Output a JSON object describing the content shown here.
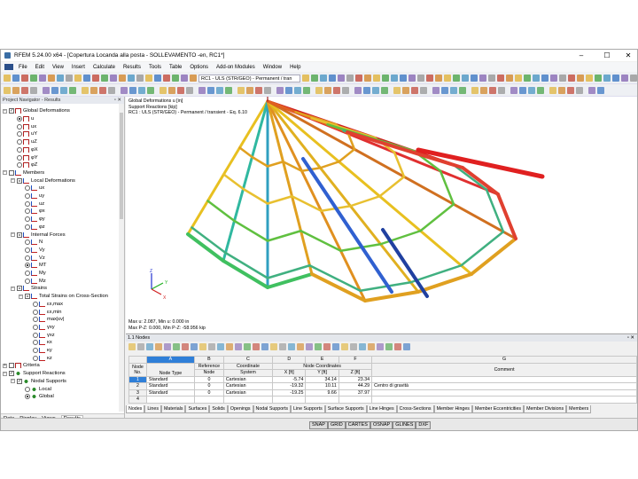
{
  "window": {
    "title": "RFEM 5.24.00 x64 - [Copertura Locanda alla posta - SOLLEVAMENTO -en, RC1*]",
    "minimize": "–",
    "maximize": "☐",
    "close": "✕"
  },
  "menu": [
    "File",
    "Edit",
    "View",
    "Insert",
    "Calculate",
    "Results",
    "Tools",
    "Table",
    "Options",
    "Add-on Modules",
    "Window",
    "Help"
  ],
  "toolbar": {
    "load_case": "RC1 - ULS (STR/GEO) - Permanent / tran"
  },
  "navigator": {
    "title": "Project Navigator - Results",
    "pin": "▫ ✕",
    "tabs": [
      "Data",
      "Display",
      "Views",
      "Results"
    ],
    "tree": [
      {
        "l": 0,
        "c": "box",
        "chk": true,
        "ic": "def",
        "t": "Global Deformations",
        "e": "-"
      },
      {
        "l": 1,
        "c": "rad",
        "on": true,
        "ic": "def",
        "t": "u"
      },
      {
        "l": 1,
        "c": "rad",
        "ic": "def",
        "t": "ux"
      },
      {
        "l": 1,
        "c": "rad",
        "ic": "def",
        "t": "uY"
      },
      {
        "l": 1,
        "c": "rad",
        "ic": "def",
        "t": "uZ"
      },
      {
        "l": 1,
        "c": "rad",
        "ic": "def",
        "t": "φX"
      },
      {
        "l": 1,
        "c": "rad",
        "ic": "def",
        "t": "φY"
      },
      {
        "l": 1,
        "c": "rad",
        "ic": "def",
        "t": "φZ"
      },
      {
        "l": 0,
        "c": "box",
        "ic": "mem",
        "t": "Members",
        "e": "-"
      },
      {
        "l": 1,
        "c": "box",
        "part": true,
        "ic": "mem",
        "t": "Local Deformations",
        "e": "-"
      },
      {
        "l": 2,
        "c": "rad",
        "ic": "mem",
        "t": "ux"
      },
      {
        "l": 2,
        "c": "rad",
        "ic": "mem",
        "t": "uy"
      },
      {
        "l": 2,
        "c": "rad",
        "ic": "mem",
        "t": "uz"
      },
      {
        "l": 2,
        "c": "rad",
        "ic": "mem",
        "t": "φx"
      },
      {
        "l": 2,
        "c": "rad",
        "ic": "mem",
        "t": "φy"
      },
      {
        "l": 2,
        "c": "rad",
        "ic": "mem",
        "t": "φz"
      },
      {
        "l": 1,
        "c": "box",
        "part": true,
        "ic": "mem",
        "t": "Internal Forces",
        "e": "-"
      },
      {
        "l": 2,
        "c": "rad",
        "ic": "mem",
        "t": "N"
      },
      {
        "l": 2,
        "c": "rad",
        "ic": "mem",
        "t": "Vy"
      },
      {
        "l": 2,
        "c": "rad",
        "ic": "mem",
        "t": "Vz"
      },
      {
        "l": 2,
        "c": "rad",
        "on": true,
        "ic": "mem",
        "t": "MT"
      },
      {
        "l": 2,
        "c": "rad",
        "ic": "mem",
        "t": "My"
      },
      {
        "l": 2,
        "c": "rad",
        "ic": "mem",
        "t": "Mz"
      },
      {
        "l": 1,
        "c": "box",
        "part": true,
        "ic": "mem",
        "t": "Strains",
        "e": "-"
      },
      {
        "l": 2,
        "c": "box",
        "part": true,
        "ic": "mem",
        "t": "Total Strains on Cross-Section",
        "e": "-"
      },
      {
        "l": 3,
        "c": "rad",
        "ic": "mem",
        "t": "εx,max"
      },
      {
        "l": 3,
        "c": "rad",
        "ic": "mem",
        "t": "εx,min"
      },
      {
        "l": 3,
        "c": "rad",
        "ic": "mem",
        "t": "max|εv|"
      },
      {
        "l": 3,
        "c": "rad",
        "ic": "mem",
        "t": "γxy"
      },
      {
        "l": 3,
        "c": "rad",
        "ic": "mem",
        "t": "γxz"
      },
      {
        "l": 3,
        "c": "rad",
        "ic": "mem",
        "t": "κx"
      },
      {
        "l": 3,
        "c": "rad",
        "ic": "mem",
        "t": "κy"
      },
      {
        "l": 3,
        "c": "rad",
        "ic": "mem",
        "t": "κz"
      },
      {
        "l": 0,
        "c": "box",
        "ic": "def",
        "t": "Criteria",
        "e": "+"
      },
      {
        "l": 0,
        "c": "box",
        "chk": true,
        "ic": "sup",
        "t": "Support Reactions",
        "e": "-"
      },
      {
        "l": 1,
        "c": "box",
        "chk": true,
        "ic": "sup",
        "t": "Nodal Supports",
        "e": "-"
      },
      {
        "l": 2,
        "c": "rad",
        "ic": "sup",
        "t": "Local"
      },
      {
        "l": 2,
        "c": "rad",
        "on": true,
        "ic": "sup",
        "t": "Global"
      }
    ]
  },
  "viewport": {
    "info": [
      "Global Deformations u [in]",
      "Support Reactions [kip]",
      "RC1 : ULS (STR/GEO) - Permanent / transient - Eq. 6.10"
    ],
    "summary": [
      "Max u: 2.087, Min u: 0.000 in",
      "Max P-Z: 0.000, Min P-Z: -58.956 kip"
    ],
    "axes": {
      "x": "X",
      "y": "Y",
      "z": "Z"
    }
  },
  "table": {
    "title": "1.1 Nodes",
    "pin": "▫ ✕",
    "col_letters": [
      "A",
      "B",
      "C",
      "D",
      "E",
      "F",
      "G"
    ],
    "headers": {
      "node_no": "Node No.",
      "node_type": "Node Type",
      "ref1": "Reference",
      "ref2": "Node",
      "cs1": "Coordinate",
      "cs2": "System",
      "coords": "Node Coordinates",
      "x": "X [ft]",
      "y": "Y [ft]",
      "z": "Z [ft]",
      "comment": "Comment"
    },
    "rows": [
      {
        "no": "1",
        "type": "Standard",
        "ref": "0",
        "cs": "Cartesian",
        "x": "-5.74",
        "y": "34.14",
        "z": "23.34",
        "comment": ""
      },
      {
        "no": "2",
        "type": "Standard",
        "ref": "0",
        "cs": "Cartesian",
        "x": "-19.32",
        "y": "10.11",
        "z": "44.29",
        "comment": "Centro di gravità"
      },
      {
        "no": "3",
        "type": "Standard",
        "ref": "0",
        "cs": "Cartesian",
        "x": "-19.25",
        "y": "9.66",
        "z": "37.97",
        "comment": ""
      },
      {
        "no": "4",
        "type": "",
        "ref": "",
        "cs": "",
        "x": "",
        "y": "",
        "z": "",
        "comment": ""
      }
    ],
    "tabs": [
      "Nodes",
      "Lines",
      "Materials",
      "Surfaces",
      "Solids",
      "Openings",
      "Nodal Supports",
      "Line Supports",
      "Surface Supports",
      "Line Hinges",
      "Cross-Sections",
      "Member Hinges",
      "Member Eccentricities",
      "Member Divisions",
      "Members"
    ]
  },
  "status": [
    "SNAP",
    "GRID",
    "CARTES",
    "OSNAP",
    "GLINES",
    "DXF"
  ]
}
